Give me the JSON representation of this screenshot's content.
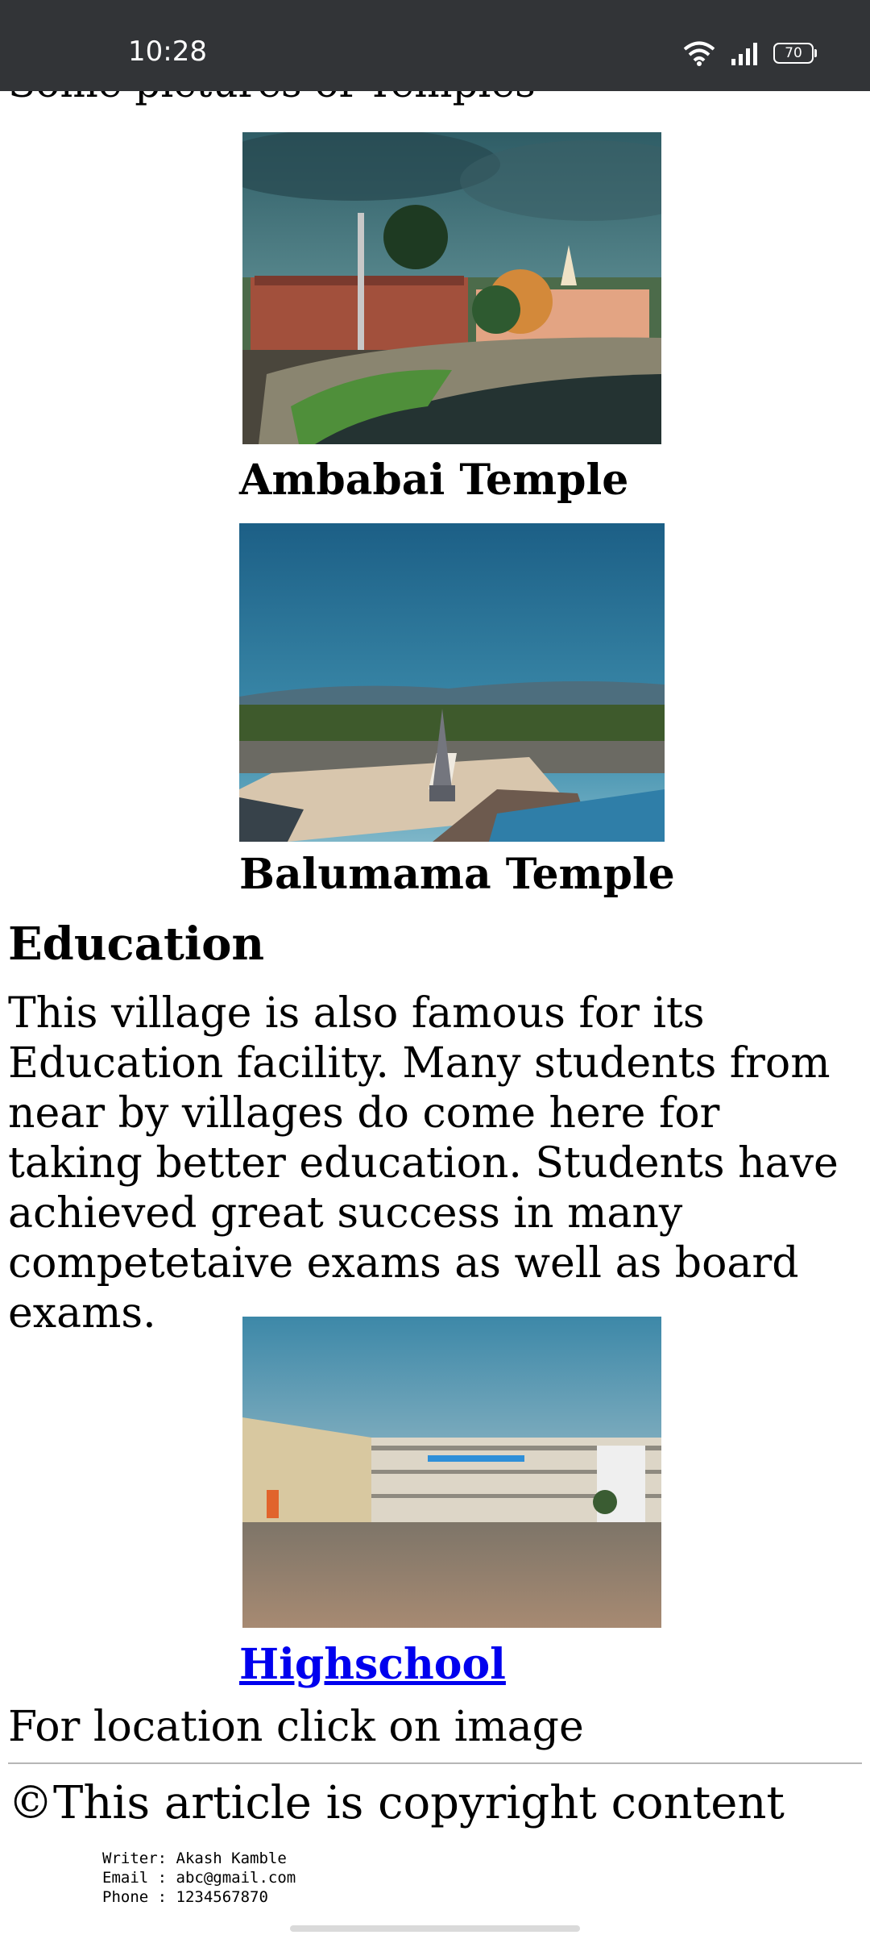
{
  "status_bar": {
    "time": "10:28",
    "battery": "70",
    "icons": [
      "wifi-icon",
      "signal-icon",
      "battery-icon"
    ]
  },
  "temples": {
    "section_heading": "Some pictures of Temples",
    "items": [
      {
        "caption": "Ambabai Temple"
      },
      {
        "caption": "Balumama Temple"
      }
    ]
  },
  "education": {
    "heading": "Education",
    "paragraph": "This village is also famous for its Education facility. Many students from near by villages do come here for taking better education. Students have achieved great success in many competetaive exams as well as board exams.",
    "image_caption_link": "Highschool"
  },
  "location_note": "For location click on image",
  "footer": {
    "copyright": "©This article is copyright content",
    "writer": "Writer: Akash Kamble",
    "email": "Email : abc@gmail.com",
    "phone": "Phone : 1234567870"
  }
}
